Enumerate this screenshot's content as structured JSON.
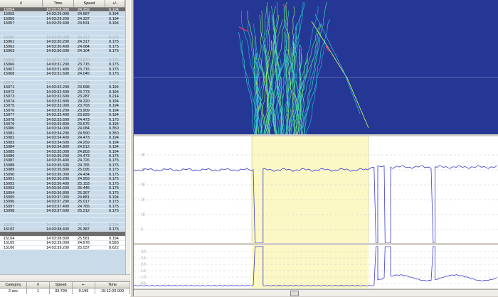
{
  "table": {
    "headers": [
      "#",
      "Time",
      "Speed",
      "+/-"
    ],
    "rows": [
      [
        "15054",
        "14:03:28.800",
        "24.259",
        "0.194"
      ],
      [
        "15055",
        "14:03:29.000",
        "24.687",
        "0.194"
      ],
      [
        "15056",
        "14:03:29.200",
        "24.337",
        "0.194"
      ],
      [
        "15057",
        "14:03:29.400",
        "24.531",
        "0.194"
      ],
      [
        "",
        "",
        "",
        ""
      ],
      [
        "",
        "",
        "",
        ""
      ],
      [
        "15060",
        "14:03:30.000",
        "24.317",
        "0.175"
      ],
      [
        "15061",
        "14:03:30.200",
        "24.317",
        "0.175"
      ],
      [
        "15062",
        "14:03:30.400",
        "24.084",
        "0.175"
      ],
      [
        "15063",
        "14:03:30.600",
        "24.104",
        "0.175"
      ],
      [
        "",
        "",
        "",
        ""
      ],
      [
        "15065",
        "14:03:31.000",
        "23.870",
        "0.175"
      ],
      [
        "15066",
        "14:03:31.200",
        "23.715",
        "0.175"
      ],
      [
        "15067",
        "14:03:31.400",
        "23.715",
        "0.175"
      ],
      [
        "15068",
        "14:03:31.600",
        "24.045",
        "0.175"
      ],
      [
        "",
        "",
        "",
        ""
      ],
      [
        "15070",
        "14:03:32.000",
        "23.793",
        "0.194"
      ],
      [
        "15071",
        "14:03:32.200",
        "23.598",
        "0.194"
      ],
      [
        "15072",
        "14:03:32.400",
        "23.773",
        "0.194"
      ],
      [
        "15073",
        "14:03:32.600",
        "23.287",
        "0.214"
      ],
      [
        "15074",
        "14:03:32.800",
        "24.220",
        "0.194"
      ],
      [
        "15075",
        "14:03:33.000",
        "23.793",
        "0.194"
      ],
      [
        "15076",
        "14:03:33.200",
        "23.909",
        "0.194"
      ],
      [
        "15077",
        "14:03:33.400",
        "23.929",
        "0.194"
      ],
      [
        "15078",
        "14:03:33.600",
        "24.473",
        "0.175"
      ],
      [
        "15079",
        "14:03:33.800",
        "23.676",
        "0.194"
      ],
      [
        "15080",
        "14:03:34.000",
        "24.084",
        "0.350"
      ],
      [
        "15081",
        "14:03:34.200",
        "24.590",
        "0.350"
      ],
      [
        "15082",
        "14:03:34.400",
        "24.473",
        "0.194"
      ],
      [
        "15083",
        "14:03:34.600",
        "24.259",
        "0.194"
      ],
      [
        "15084",
        "14:03:34.800",
        "24.512",
        "0.194"
      ],
      [
        "15085",
        "14:03:35.000",
        "24.803",
        "0.194"
      ],
      [
        "15086",
        "14:03:35.200",
        "24.473",
        "0.175"
      ],
      [
        "15087",
        "14:03:35.400",
        "24.726",
        "0.175"
      ],
      [
        "15088",
        "14:03:35.600",
        "24.765",
        "0.175"
      ],
      [
        "15089",
        "14:03:35.800",
        "25.095",
        "0.175"
      ],
      [
        "15090",
        "14:03:36.000",
        "24.434",
        "0.175"
      ],
      [
        "15091",
        "14:03:36.200",
        "24.959",
        "0.175"
      ],
      [
        "15092",
        "14:03:36.400",
        "25.153",
        "0.175"
      ],
      [
        "15093",
        "14:03:36.600",
        "25.445",
        "0.175"
      ],
      [
        "15094",
        "14:03:36.800",
        "25.367",
        "0.175"
      ],
      [
        "15095",
        "14:03:37.000",
        "24.881",
        "0.194"
      ],
      [
        "15096",
        "14:03:37.200",
        "25.017",
        "0.175"
      ],
      [
        "15097",
        "14:03:37.400",
        "24.765",
        "0.175"
      ],
      [
        "15098",
        "14:03:37.600",
        "25.212",
        "0.175"
      ],
      [
        "",
        "",
        "",
        ""
      ],
      [
        "",
        "",
        "",
        ""
      ],
      [
        "15101",
        "14:03:38.200",
        "25.784",
        "0.194"
      ],
      [
        "15102",
        "14:03:38.400",
        "25.387",
        "0.175"
      ],
      [
        "",
        "",
        "",
        ""
      ],
      [
        "15104",
        "14:03:38.800",
        "25.581",
        "0.194"
      ],
      [
        "15105",
        "14:03:39.000",
        "24.978",
        "0.583"
      ],
      [
        "15106",
        "14:03:39.200",
        "25.037",
        "0.622"
      ]
    ]
  },
  "summary": {
    "headers": [
      "Category",
      "#",
      "Speed",
      "+-",
      "Time"
    ],
    "values": [
      "2 sec",
      "1",
      "33.790",
      "0.195",
      "15:12:20.000"
    ]
  },
  "chart2": {
    "ticks": [
      "30",
      "25",
      "20",
      "15",
      "10",
      "5"
    ],
    "bounds": [
      [
        0,
        0.333
      ],
      [
        0.345,
        0.34
      ],
      [
        0.355,
        0.665
      ],
      [
        0.67,
        0.69
      ],
      [
        0.705,
        0.822
      ],
      [
        0.827,
        1.0
      ]
    ]
  },
  "chart3": {
    "ticks": [
      "3.0",
      "2.5",
      "2.0",
      "1.5",
      "1.0",
      "0.5"
    ]
  },
  "colors": {
    "panel_bg": "#253794",
    "highlight": "#fbf8c6",
    "selected_row": "#6d6d6d",
    "line": "#3a3ad0"
  }
}
